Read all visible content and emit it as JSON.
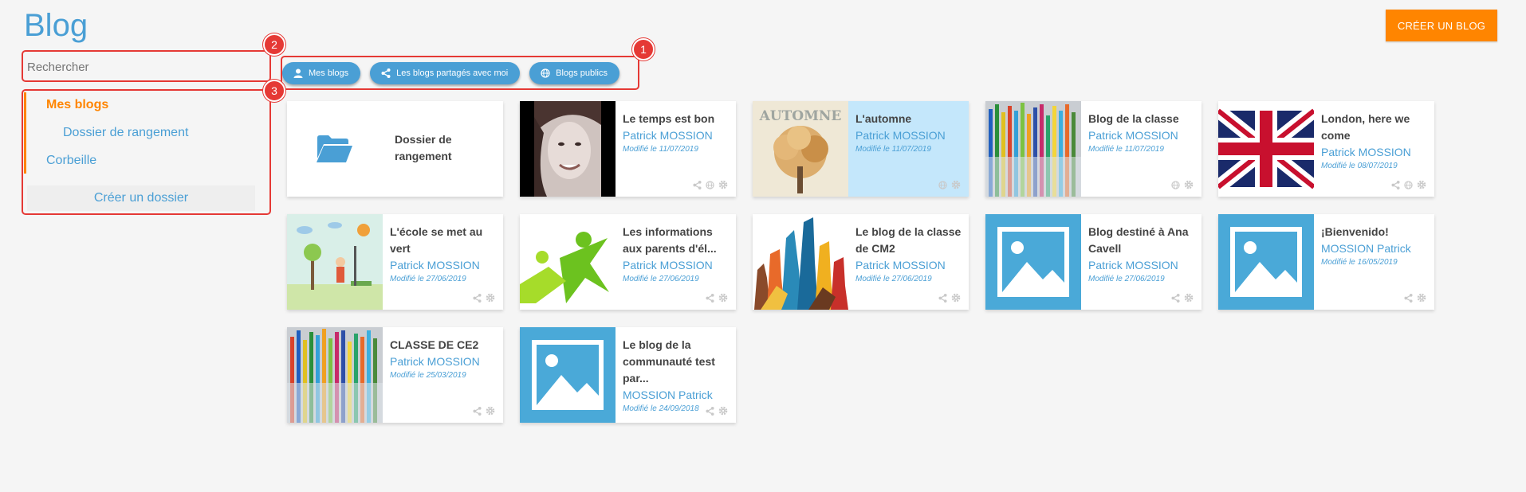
{
  "header": {
    "title": "Blog",
    "create_button": "CRÉER UN BLOG"
  },
  "search": {
    "placeholder": "Rechercher"
  },
  "filters": [
    {
      "label": "Mes blogs",
      "icon": "user-icon"
    },
    {
      "label": "Les blogs partagés avec moi",
      "icon": "share-icon"
    },
    {
      "label": "Blogs publics",
      "icon": "globe-icon"
    }
  ],
  "folders": {
    "my_blogs": "Mes blogs",
    "storage_folder": "Dossier de rangement",
    "trash": "Corbeille",
    "create_folder": "Créer un dossier"
  },
  "annotations": [
    "1",
    "2",
    "3"
  ],
  "folder_card": {
    "title": "Dossier de rangement",
    "icon": "open-folder-icon"
  },
  "blogs": [
    {
      "title": "Le temps est bon",
      "author": "Patrick MOSSION",
      "modified": "Modifié le 11/07/2019",
      "thumb": "woman-portrait-image",
      "actions": [
        "share-icon",
        "globe-icon",
        "gear-icon"
      ],
      "highlighted": false
    },
    {
      "title": "L'automne",
      "author": "Patrick MOSSION",
      "modified": "Modifié le 11/07/2019",
      "thumb": "autumn-tree-image",
      "thumb_text": "AUTOMNE",
      "actions": [
        "globe-icon",
        "gear-icon"
      ],
      "highlighted": true
    },
    {
      "title": "Blog de la classe",
      "author": "Patrick MOSSION",
      "modified": "Modifié le 11/07/2019",
      "thumb": "colored-pencils-image",
      "actions": [
        "globe-icon",
        "gear-icon"
      ],
      "highlighted": false
    },
    {
      "title": "London, here we come",
      "author": "Patrick MOSSION",
      "modified": "Modifié le 08/07/2019",
      "thumb": "union-jack-flag-image",
      "actions": [
        "share-icon",
        "globe-icon",
        "gear-icon"
      ],
      "highlighted": false
    },
    {
      "title": "L'école se met au vert",
      "author": "Patrick MOSSION",
      "modified": "Modifié le 27/06/2019",
      "thumb": "park-illustration-image",
      "actions": [
        "share-icon",
        "gear-icon"
      ],
      "highlighted": false
    },
    {
      "title": "Les informations aux parents d'él...",
      "author": "Patrick MOSSION",
      "modified": "Modifié le 27/06/2019",
      "thumb": "green-figures-image",
      "actions": [
        "share-icon",
        "gear-icon"
      ],
      "highlighted": false
    },
    {
      "title": "Le blog de la classe de CM2",
      "author": "Patrick MOSSION",
      "modified": "Modifié le 27/06/2019",
      "thumb": "raised-hands-image",
      "actions": [
        "share-icon",
        "gear-icon"
      ],
      "highlighted": false
    },
    {
      "title": "Blog destiné à Ana Cavell",
      "author": "Patrick MOSSION",
      "modified": "Modifié le 27/06/2019",
      "thumb": "placeholder-image",
      "actions": [
        "share-icon",
        "gear-icon"
      ],
      "highlighted": false
    },
    {
      "title": "¡Bienvenido!",
      "author": "MOSSION Patrick",
      "modified": "Modifié le 16/05/2019",
      "thumb": "placeholder-image",
      "actions": [
        "share-icon",
        "gear-icon"
      ],
      "highlighted": false
    },
    {
      "title": "CLASSE DE CE2",
      "author": "Patrick MOSSION",
      "modified": "Modifié le 25/03/2019",
      "thumb": "colored-pencils-image",
      "actions": [
        "share-icon",
        "gear-icon"
      ],
      "highlighted": false
    },
    {
      "title": "Le blog de la communauté test par...",
      "author": "MOSSION Patrick",
      "modified": "Modifié le 24/09/2018",
      "thumb": "placeholder-image",
      "actions": [
        "share-icon",
        "gear-icon"
      ],
      "highlighted": false
    }
  ],
  "colors": {
    "accent": "#4a9fd5",
    "orange": "#ff8500",
    "annotation": "#e53935",
    "highlight": "#c4e7fb"
  }
}
